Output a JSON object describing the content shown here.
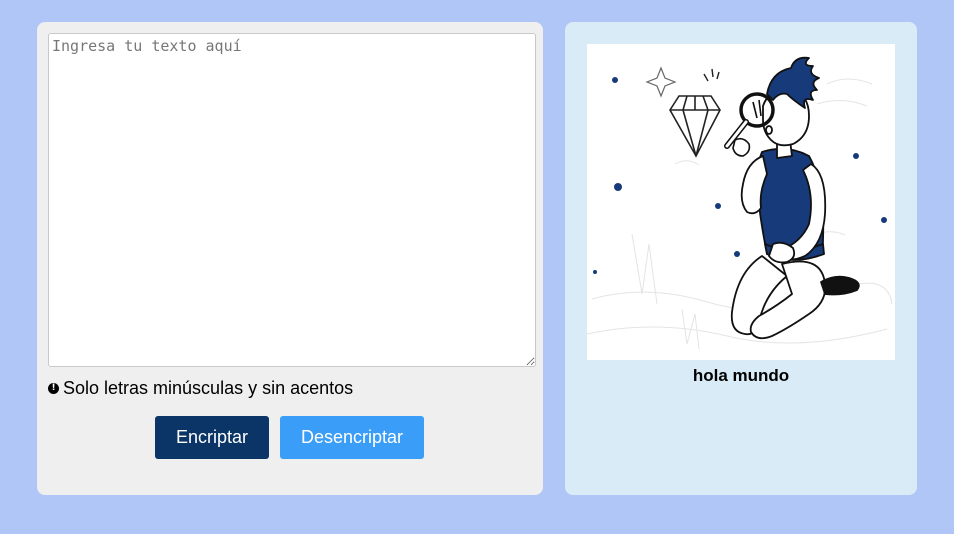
{
  "input": {
    "placeholder": "Ingresa tu texto aquí",
    "value": ""
  },
  "hint": {
    "icon": "info-icon",
    "icon_glyph": "!",
    "text": "Solo letras minúsculas y sin acentos"
  },
  "buttons": {
    "encrypt_label": "Encriptar",
    "decrypt_label": "Desencriptar"
  },
  "output": {
    "illustration": "person-with-magnifying-glass-and-diamond-illustration",
    "text": "hola mundo"
  },
  "colors": {
    "background": "#AFC6F6",
    "left_panel": "#EFEFEF",
    "right_panel": "#D9EBF6",
    "encrypt_button": "#0A3566",
    "decrypt_button": "#3A9DF8",
    "illustration_accent": "#173B7A"
  }
}
